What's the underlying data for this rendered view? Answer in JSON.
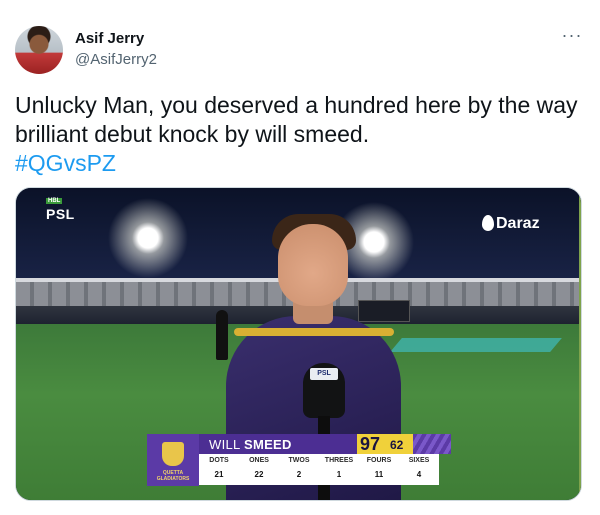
{
  "author": {
    "name": "Asif Jerry",
    "handle": "@AsifJerry2"
  },
  "more_menu_label": "···",
  "tweet": {
    "line1": "Unlucky Man, you deserved a hundred here by the way",
    "line2": "brilliant debut knock by will smeed.",
    "hashtag": "#QGvsPZ"
  },
  "media": {
    "league_logo": "PSL",
    "league_sponsor": "HBL",
    "sponsor_logo": "Daraz",
    "mic_label": "PSL",
    "team_badge_text": "QUETTA GLADIATORS",
    "player_first": "WILL",
    "player_last": "SMEED",
    "runs": "97",
    "balls": "62",
    "stats": [
      {
        "label": "DOTS",
        "value": "21"
      },
      {
        "label": "ONES",
        "value": "22"
      },
      {
        "label": "TWOS",
        "value": "2"
      },
      {
        "label": "THREES",
        "value": "1"
      },
      {
        "label": "FOURS",
        "value": "11"
      },
      {
        "label": "SIXES",
        "value": "4"
      }
    ]
  },
  "colors": {
    "hashtag": "#1d9bf0",
    "handle": "#536471",
    "team_purple": "#4c2e93",
    "score_yellow": "#f0d13a"
  }
}
